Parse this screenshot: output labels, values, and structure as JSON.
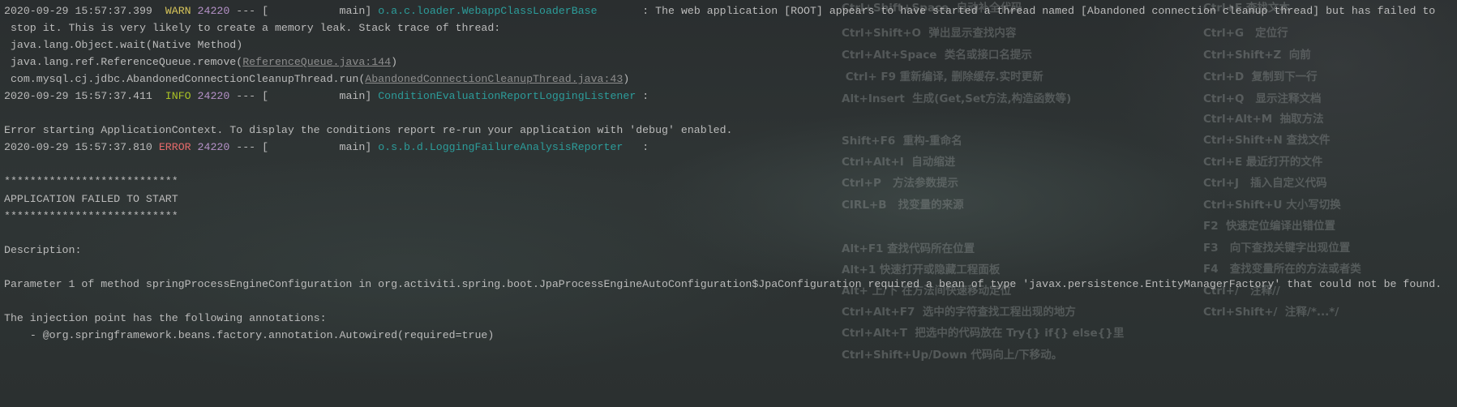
{
  "colors": {
    "warn": "#d6c45a",
    "info": "#a9c125",
    "error": "#e56a6a",
    "pid": "#b592c8",
    "logger": "#2c9c9a",
    "text": "#bbbbbb"
  },
  "shortcuts_left": [
    "Ctrl+Shift+Space  自动补全代码",
    "Ctrl+Shift+O  弹出显示查找内容",
    "Ctrl+Alt+Space  类名或接口名提示",
    " Ctrl+ F9 重新编译, 删除缓存.实时更新",
    "Alt+Insert  生成(Get,Set方法,构造函数等)",
    "Shift+F6  重构-重命名",
    "Ctrl+Alt+I  自动缩进",
    "Ctrl+P   方法参数提示",
    "CIRL+B   找变量的来源",
    "Alt+F1 查找代码所在位置",
    "Alt+1 快速打开或隐藏工程面板",
    "Alt+ 上/下 在方法间快速移动定位",
    "Ctrl+Alt+F7  选中的字符查找工程出现的地方",
    "Ctrl+Alt+T  把选中的代码放在 Try{} if{} else{}里",
    "Ctrl+Shift+Up/Down 代码向上/下移动。"
  ],
  "shortcuts_right": [
    "Ctrl+F 查找文本",
    "Ctrl+G   定位行",
    "Ctrl+Shift+Z  向前",
    "Ctrl+D  复制到下一行",
    "Ctrl+Q   显示注释文档",
    "Ctrl+Alt+M  抽取方法",
    "Ctrl+Shift+N 查找文件",
    "Ctrl+E 最近打开的文件",
    "Ctrl+J   插入自定义代码",
    "Ctrl+Shift+U 大小写切换",
    "F2  快速定位编译出错位置",
    "F3   向下查找关键字出现位置",
    "F4   查找变量所在的方法或者类",
    "Ctrl+/   注释//",
    "Ctrl+Shift+/  注释/*...*/"
  ],
  "log": {
    "l1": {
      "ts": "2020-09-29 15:57:37.399  ",
      "level": "WARN",
      "pid": " 24220",
      "thread": " --- [           main] ",
      "logger": "o.a.c.loader.WebappClassLoaderBase",
      "msg": "       : The web application [ROOT] appears to have started a thread named [Abandoned connection cleanup thread] but has failed to"
    },
    "l2": " stop it. This is very likely to create a memory leak. Stack trace of thread:",
    "l3": " java.lang.Object.wait(Native Method)",
    "l4": {
      "pre": " java.lang.ref.ReferenceQueue.remove(",
      "link": "ReferenceQueue.java:144",
      "post": ")"
    },
    "l5": {
      "pre": " com.mysql.cj.jdbc.AbandonedConnectionCleanupThread.run(",
      "link": "AbandonedConnectionCleanupThread.java:43",
      "post": ")"
    },
    "l6": {
      "ts": "2020-09-29 15:57:37.411  ",
      "level": "INFO",
      "pid": " 24220",
      "thread": " --- [           main] ",
      "logger": "ConditionEvaluationReportLoggingListener",
      "msg": " :"
    },
    "l8": "Error starting ApplicationContext. To display the conditions report re-run your application with 'debug' enabled.",
    "l9": {
      "ts": "2020-09-29 15:57:37.810 ",
      "level": "ERROR",
      "pid": " 24220",
      "thread": " --- [           main] ",
      "logger": "o.s.b.d.LoggingFailureAnalysisReporter",
      "msg": "   :"
    },
    "l11": "***************************",
    "l12": "APPLICATION FAILED TO START",
    "l13": "***************************",
    "l15": "Description:",
    "l17": "Parameter 1 of method springProcessEngineConfiguration in org.activiti.spring.boot.JpaProcessEngineAutoConfiguration$JpaConfiguration required a bean of type 'javax.persistence.EntityManagerFactory' that could not be found.",
    "l19": "The injection point has the following annotations:",
    "l20": "\t- @org.springframework.beans.factory.annotation.Autowired(required=true)"
  }
}
